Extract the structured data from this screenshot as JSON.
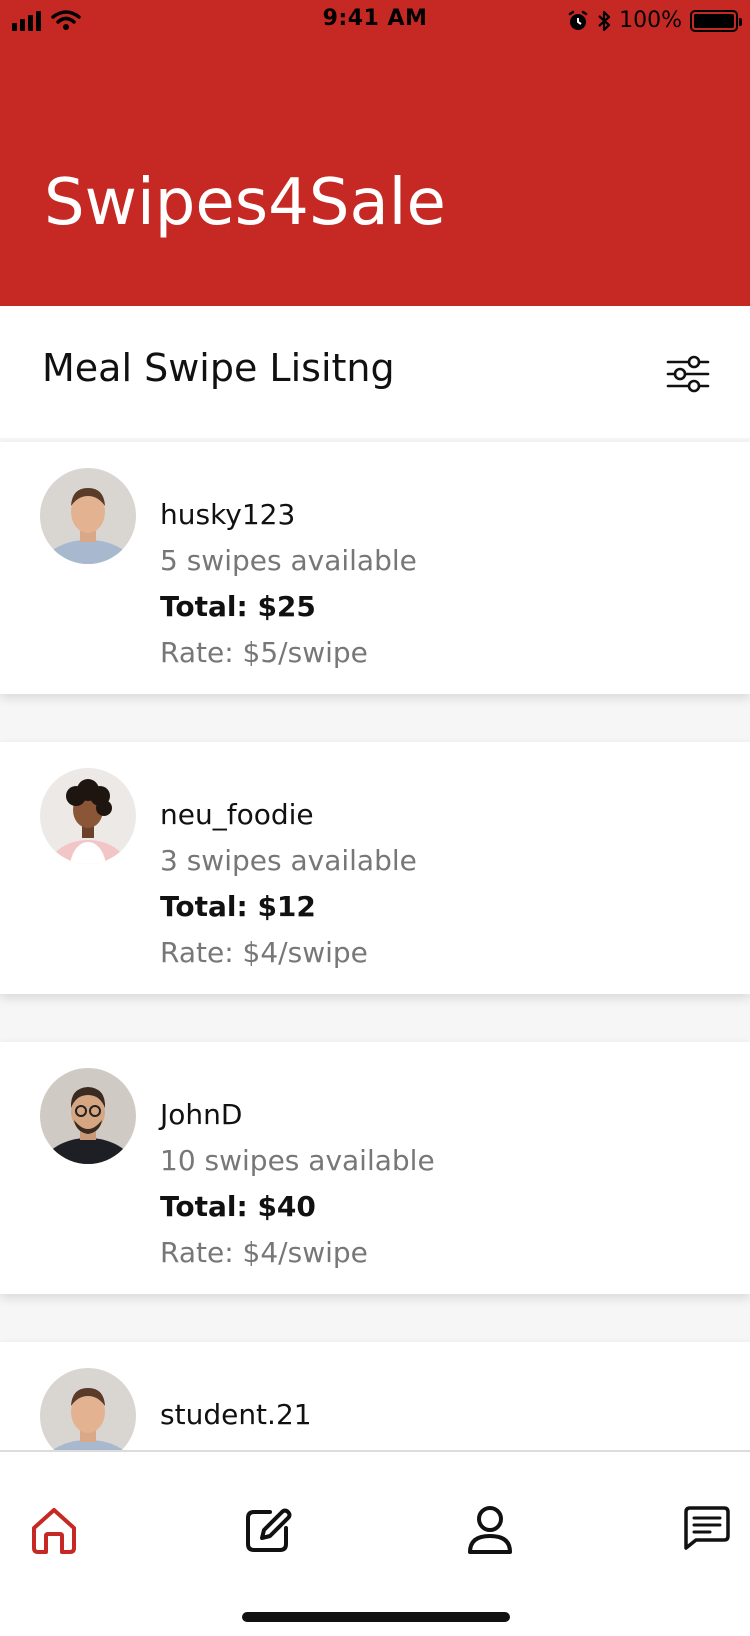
{
  "status_bar": {
    "time": "9:41 AM",
    "battery": "100%"
  },
  "app": {
    "title": "Swipes4Sale",
    "accent_color": "#c62823"
  },
  "section": {
    "title": "Meal Swipe Lisitng",
    "filter_icon": "sliders-icon"
  },
  "listings": [
    {
      "username": "husky123",
      "swipes": "5 swipes available",
      "total": "Total: $25",
      "rate": "Rate: $5/swipe"
    },
    {
      "username": "neu_foodie",
      "swipes": "3 swipes available",
      "total": "Total: $12",
      "rate": "Rate: $4/swipe"
    },
    {
      "username": "JohnD",
      "swipes": "10 swipes available",
      "total": "Total: $40",
      "rate": "Rate: $4/swipe"
    },
    {
      "username": "student.21",
      "swipes": "",
      "total": "",
      "rate": ""
    }
  ],
  "tabbar": {
    "items": [
      {
        "name": "home",
        "icon": "home-icon",
        "active": true
      },
      {
        "name": "edit",
        "icon": "edit-icon",
        "active": false
      },
      {
        "name": "profile",
        "icon": "user-icon",
        "active": false
      },
      {
        "name": "messages",
        "icon": "chat-icon",
        "active": false
      }
    ]
  }
}
